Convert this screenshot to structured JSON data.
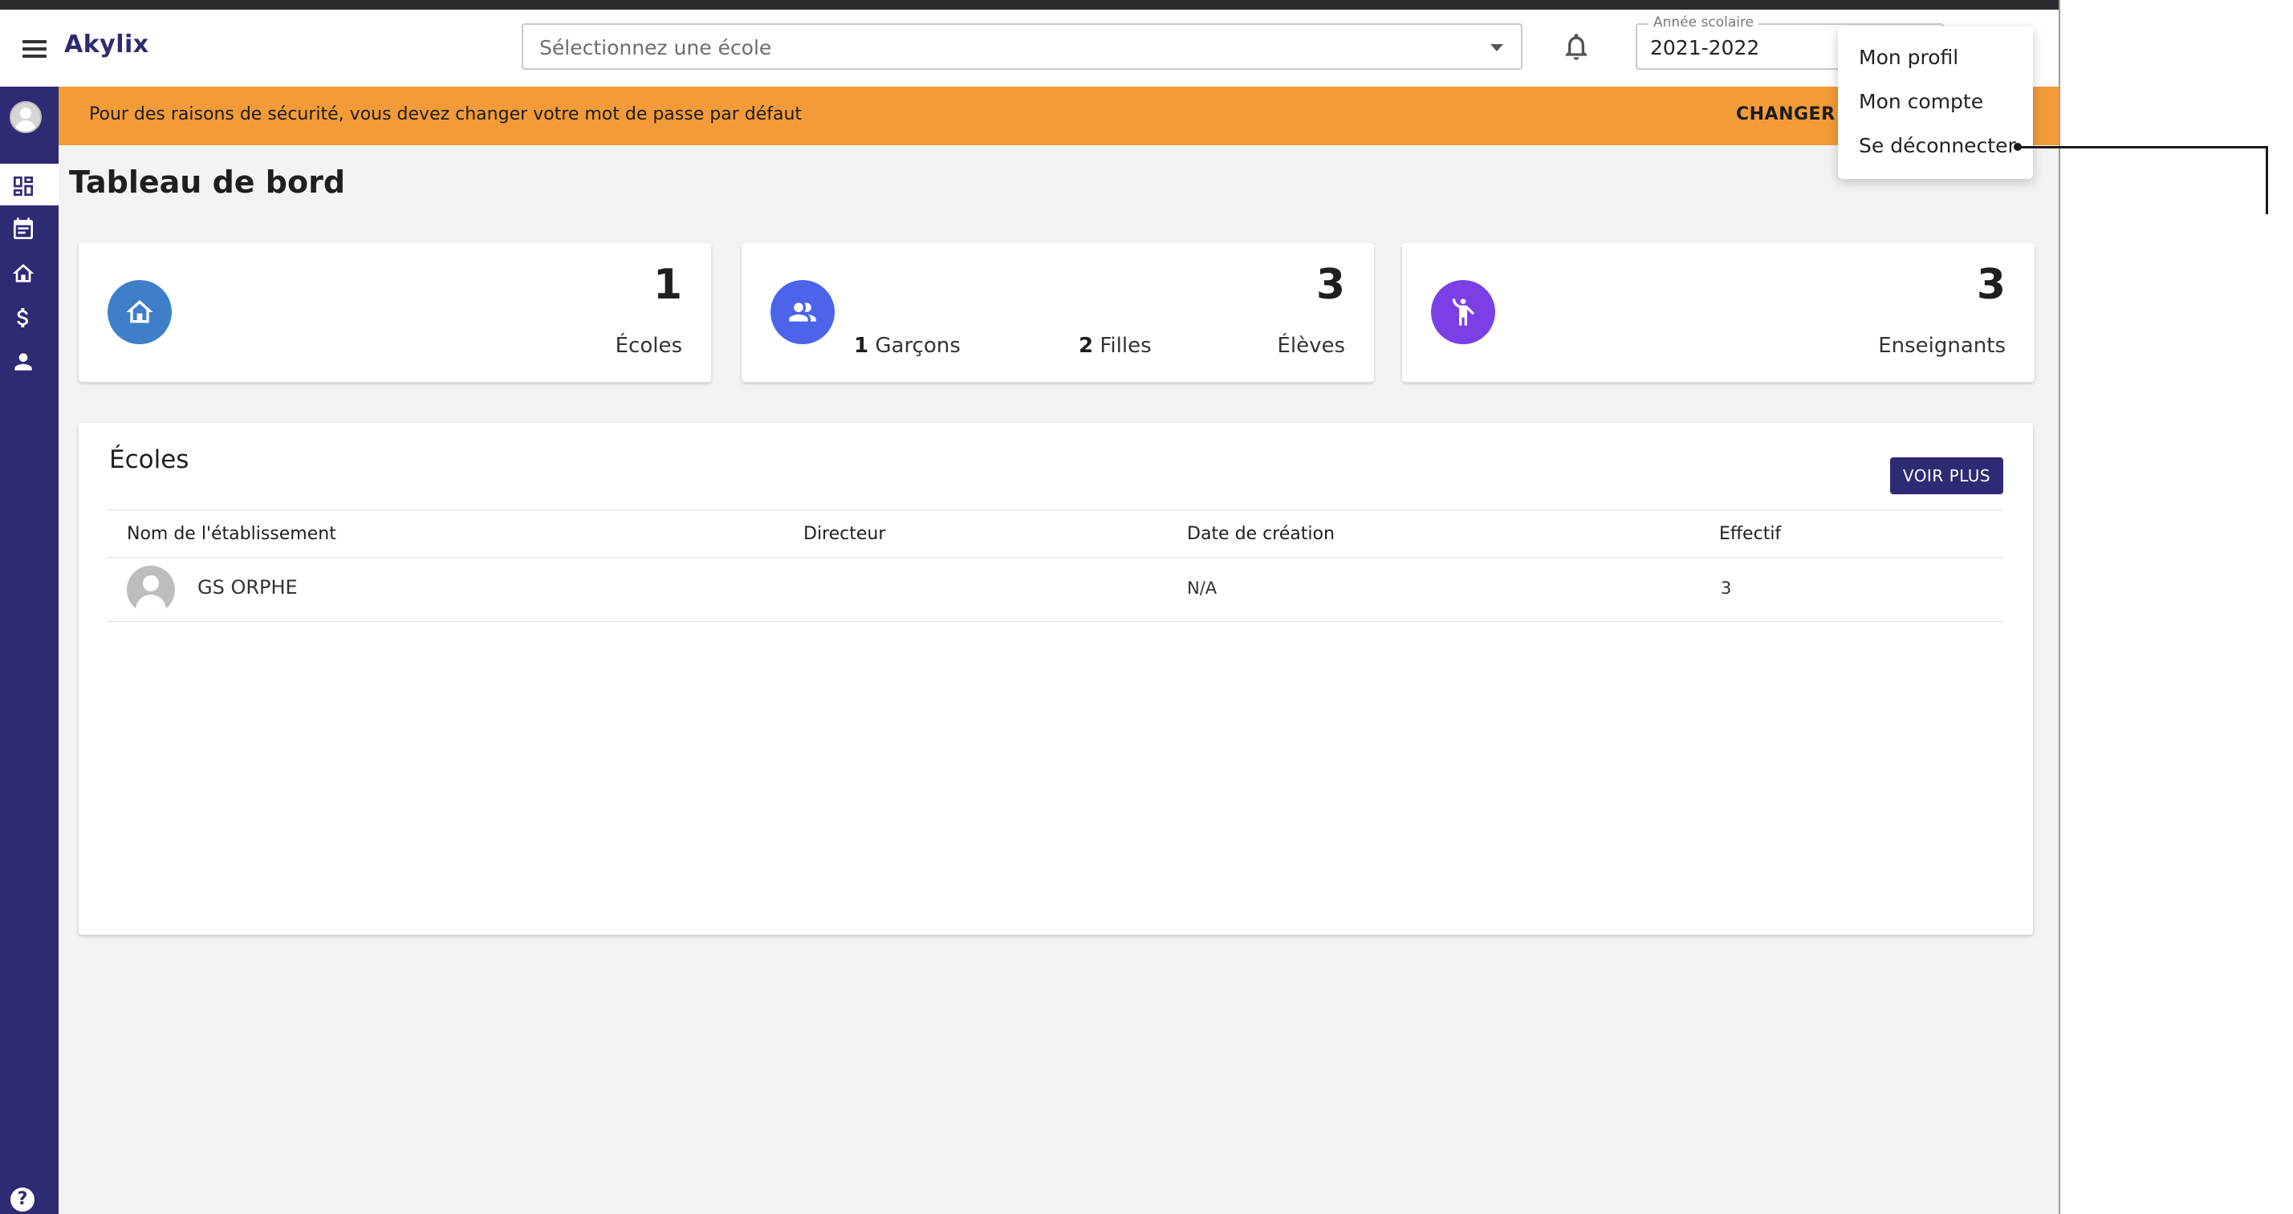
{
  "header": {
    "app_name": "Akylix",
    "school_placeholder": "Sélectionnez une école",
    "year_label": "Année scolaire",
    "year_value": "2021-2022"
  },
  "alert": {
    "message": "Pour des raisons de sécurité, vous devez changer votre mot de passe par défaut",
    "action": "CHANGER M"
  },
  "page": {
    "title": "Tableau de bord"
  },
  "cards": {
    "ecoles": {
      "count": "1",
      "label": "Écoles"
    },
    "eleves": {
      "count": "3",
      "label": "Élèves",
      "boys_count": "1",
      "boys_label": " Garçons",
      "girls_count": "2",
      "girls_label": " Filles"
    },
    "enseignants": {
      "count": "3",
      "label": "Enseignants"
    }
  },
  "schools": {
    "title": "Écoles",
    "more_button": "VOIR PLUS",
    "columns": [
      "Nom de l'établissement",
      "Directeur",
      "Date de création",
      "Effectif"
    ],
    "rows": [
      {
        "name": "GS ORPHE",
        "director": "",
        "created": "N/A",
        "effectif": "3"
      }
    ]
  },
  "user_menu": {
    "items": [
      "Mon profil",
      "Mon compte",
      "Se déconnecter"
    ]
  },
  "sidebar": {
    "items": [
      "dashboard-icon",
      "calendar-icon",
      "home-icon",
      "dollar-icon",
      "person-icon"
    ],
    "help": "?"
  },
  "colors": {
    "primary": "#2e2a73",
    "alert": "#f29b38",
    "ecoles_icon": "#3f7fc9",
    "eleves_icon": "#4c63ea",
    "enseignants_icon": "#7b3fe6"
  }
}
